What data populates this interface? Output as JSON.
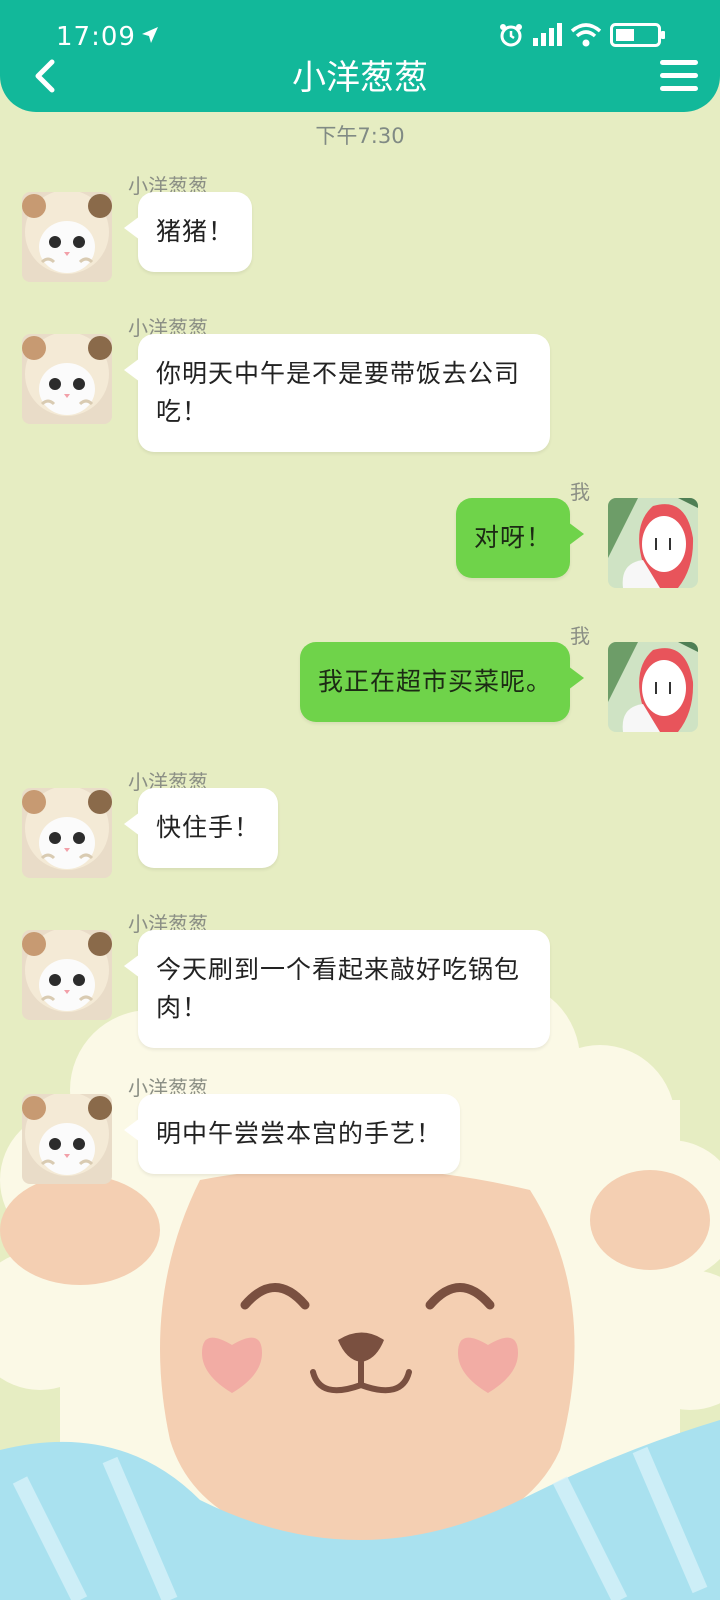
{
  "status_bar": {
    "time": "17:09"
  },
  "header": {
    "title": "小洋葱葱"
  },
  "time_divider": "下午7:30",
  "messages": [
    {
      "side": "left",
      "sender": "小洋葱葱",
      "text": "猪猪！"
    },
    {
      "side": "left",
      "sender": "小洋葱葱",
      "text": "你明天中午是不是要带饭去公司吃！"
    },
    {
      "side": "right",
      "sender": "我",
      "text": "对呀！"
    },
    {
      "side": "right",
      "sender": "我",
      "text": "我正在超市买菜呢。"
    },
    {
      "side": "left",
      "sender": "小洋葱葱",
      "text": "快住手！"
    },
    {
      "side": "left",
      "sender": "小洋葱葱",
      "text": "今天刷到一个看起来敲好吃锅包肉！"
    },
    {
      "side": "left",
      "sender": "小洋葱葱",
      "text": "明中午尝尝本宫的手艺！"
    }
  ],
  "colors": {
    "header": "#12b89a",
    "background": "#e6edc2",
    "my_bubble": "#6fd34a",
    "their_bubble": "#ffffff"
  },
  "icons": {
    "back": "chevron-left-icon",
    "menu": "hamburger-menu-icon",
    "alarm": "alarm-icon",
    "signal": "signal-icon",
    "wifi": "wifi-icon",
    "battery": "battery-icon",
    "location": "location-arrow-icon"
  }
}
